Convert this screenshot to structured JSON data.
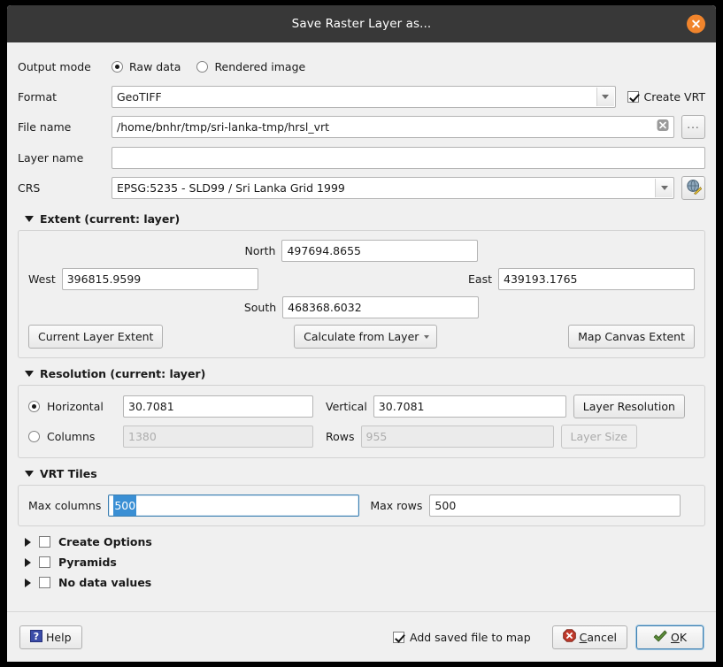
{
  "window": {
    "title": "Save Raster Layer as...",
    "close_icon": "close-circle-icon",
    "accent": "#f0842c",
    "titlebar_bg": "#383838",
    "dialog_bg": "#f0f0f0",
    "focus_blue": "#3c7fb1",
    "selection_blue": "#3a8fd4"
  },
  "output_mode": {
    "label": "Output mode",
    "options": [
      {
        "label": "Raw data",
        "checked": true
      },
      {
        "label": "Rendered image",
        "checked": false
      }
    ]
  },
  "format": {
    "label": "Format",
    "value": "GeoTIFF",
    "dropdown_icon": "chevron-down-icon",
    "create_vrt": {
      "label": "Create VRT",
      "checked": true
    }
  },
  "file_name": {
    "label": "File name",
    "value": "/home/bnhr/tmp/sri-lanka-tmp/hrsl_vrt",
    "clear_icon": "clear-x-icon",
    "browse_label": "...",
    "browse_icon": "ellipsis-icon"
  },
  "layer_name": {
    "label": "Layer name",
    "value": "",
    "placeholder": ""
  },
  "crs": {
    "label": "CRS",
    "value": "EPSG:5235 - SLD99 / Sri Lanka Grid 1999",
    "dropdown_icon": "chevron-down-icon",
    "select_icon": "crs-globe-icon"
  },
  "extent": {
    "title": "Extent (current: layer)",
    "expanded": true,
    "north": {
      "label": "North",
      "value": "497694.8655"
    },
    "west": {
      "label": "West",
      "value": "396815.9599"
    },
    "east": {
      "label": "East",
      "value": "439193.1765"
    },
    "south": {
      "label": "South",
      "value": "468368.6032"
    },
    "buttons": {
      "current_layer_extent": "Current Layer Extent",
      "calculate_from_layer": "Calculate from Layer",
      "map_canvas_extent": "Map Canvas Extent"
    }
  },
  "resolution": {
    "title": "Resolution (current: layer)",
    "expanded": true,
    "horizontal": {
      "label": "Horizontal",
      "value": "30.7081",
      "selected": true
    },
    "vertical": {
      "label": "Vertical",
      "value": "30.7081"
    },
    "columns": {
      "label": "Columns",
      "value": "1380",
      "selected": false,
      "disabled": true
    },
    "rows": {
      "label": "Rows",
      "value": "955",
      "disabled": true
    },
    "layer_resolution_button": {
      "label": "Layer Resolution",
      "disabled": false
    },
    "layer_size_button": {
      "label": "Layer Size",
      "disabled": true
    }
  },
  "vrt_tiles": {
    "title": "VRT Tiles",
    "expanded": true,
    "max_columns": {
      "label": "Max columns",
      "value": "500",
      "focused": true,
      "text_selected": true
    },
    "max_rows": {
      "label": "Max rows",
      "value": "500"
    }
  },
  "collapsed_sections": [
    {
      "label": "Create Options",
      "checked": false,
      "expanded": false
    },
    {
      "label": "Pyramids",
      "checked": false,
      "expanded": false
    },
    {
      "label": "No data values",
      "checked": false,
      "expanded": false
    }
  ],
  "footer": {
    "help": {
      "label": "Help",
      "icon": "help-question-icon"
    },
    "add_saved_file_to_map": {
      "label": "Add saved file to map",
      "checked": true
    },
    "cancel": {
      "label": "Cancel",
      "icon": "cancel-x-icon",
      "mnemonic": "C"
    },
    "ok": {
      "label": "OK",
      "icon": "ok-check-icon",
      "mnemonic": "O",
      "focused": true
    }
  }
}
